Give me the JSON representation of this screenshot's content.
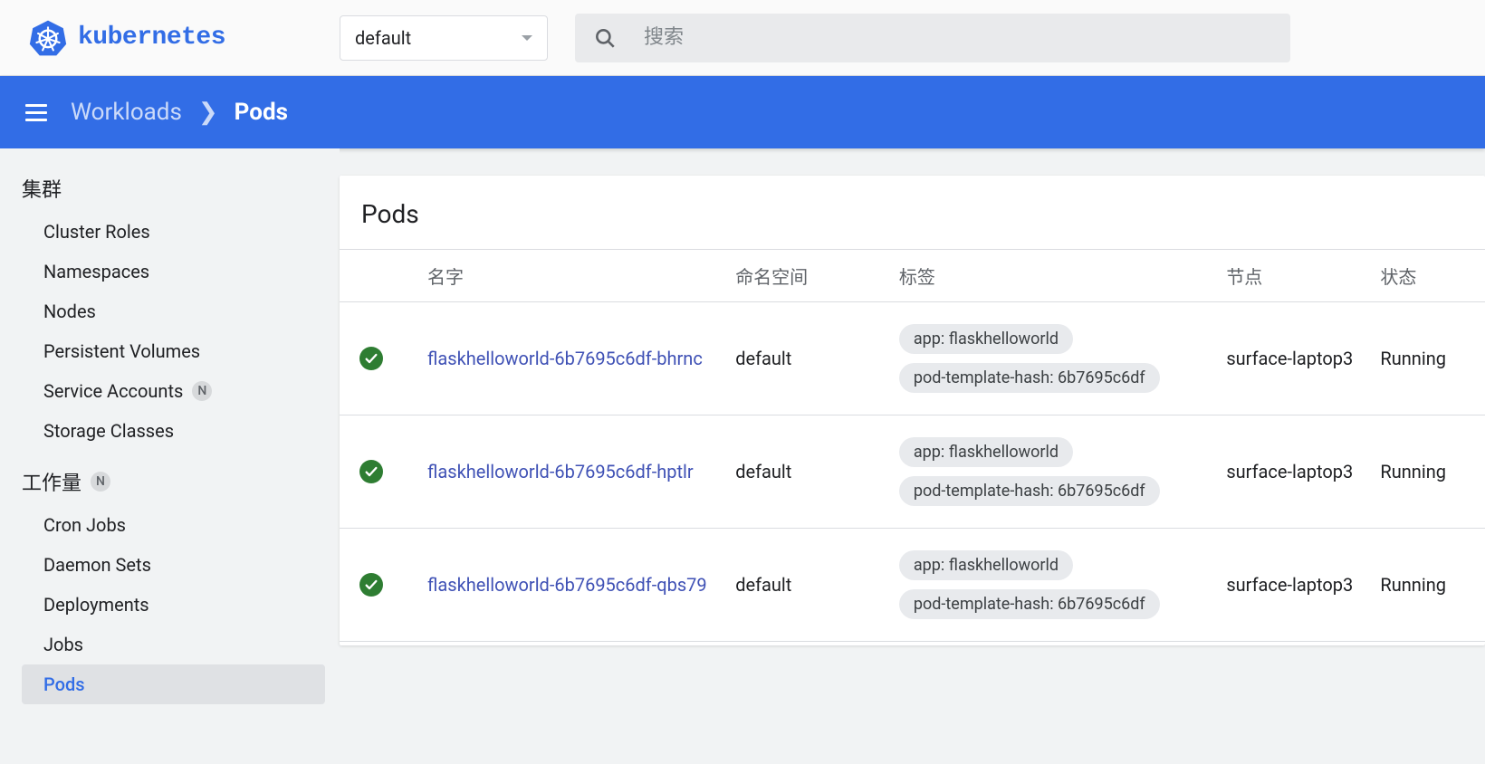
{
  "header": {
    "namespace_selected": "default",
    "search_placeholder": "搜索"
  },
  "breadcrumb": {
    "parent": "Workloads",
    "current": "Pods"
  },
  "sidebar": {
    "sections": [
      {
        "title": "集群",
        "badge": "",
        "items": [
          {
            "label": "Cluster Roles",
            "badge": "",
            "active": false
          },
          {
            "label": "Namespaces",
            "badge": "",
            "active": false
          },
          {
            "label": "Nodes",
            "badge": "",
            "active": false
          },
          {
            "label": "Persistent Volumes",
            "badge": "",
            "active": false
          },
          {
            "label": "Service Accounts",
            "badge": "N",
            "active": false
          },
          {
            "label": "Storage Classes",
            "badge": "",
            "active": false
          }
        ]
      },
      {
        "title": "工作量",
        "badge": "N",
        "items": [
          {
            "label": "Cron Jobs",
            "badge": "",
            "active": false
          },
          {
            "label": "Daemon Sets",
            "badge": "",
            "active": false
          },
          {
            "label": "Deployments",
            "badge": "",
            "active": false
          },
          {
            "label": "Jobs",
            "badge": "",
            "active": false
          },
          {
            "label": "Pods",
            "badge": "",
            "active": true
          }
        ]
      }
    ]
  },
  "pods_panel": {
    "title": "Pods",
    "columns": {
      "name": "名字",
      "namespace": "命名空间",
      "labels": "标签",
      "node": "节点",
      "state": "状态"
    },
    "rows": [
      {
        "status": "ok",
        "name": "flaskhelloworld-6b7695c6df-bhrnc",
        "namespace": "default",
        "labels": [
          "app: flaskhelloworld",
          "pod-template-hash: 6b7695c6df"
        ],
        "node": "surface-laptop3",
        "state": "Running"
      },
      {
        "status": "ok",
        "name": "flaskhelloworld-6b7695c6df-hptlr",
        "namespace": "default",
        "labels": [
          "app: flaskhelloworld",
          "pod-template-hash: 6b7695c6df"
        ],
        "node": "surface-laptop3",
        "state": "Running"
      },
      {
        "status": "ok",
        "name": "flaskhelloworld-6b7695c6df-qbs79",
        "namespace": "default",
        "labels": [
          "app: flaskhelloworld",
          "pod-template-hash: 6b7695c6df"
        ],
        "node": "surface-laptop3",
        "state": "Running"
      }
    ]
  }
}
